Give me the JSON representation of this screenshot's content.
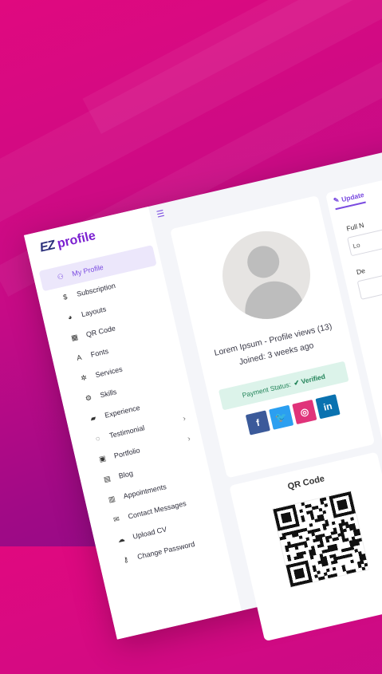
{
  "logo": {
    "mark": "EZ",
    "text": "profile"
  },
  "sidebar": {
    "items": [
      {
        "label": "My Profile",
        "icon": "user-icon",
        "glyph": "⚇",
        "active": true
      },
      {
        "label": "Subscription",
        "icon": "dollar-icon",
        "glyph": "$"
      },
      {
        "label": "Layouts",
        "icon": "palette-icon",
        "glyph": "◕"
      },
      {
        "label": "QR Code",
        "icon": "qrcode-icon",
        "glyph": "▦"
      },
      {
        "label": "Fonts",
        "icon": "font-icon",
        "glyph": "A"
      },
      {
        "label": "Services",
        "icon": "gear-icon",
        "glyph": "✲"
      },
      {
        "label": "Skills",
        "icon": "gears-icon",
        "glyph": "⚙"
      },
      {
        "label": "Experience",
        "icon": "book-icon",
        "glyph": "▰"
      },
      {
        "label": "Testimonial",
        "icon": "comment-icon",
        "glyph": "◌",
        "chevron": "›"
      },
      {
        "label": "Portfolio",
        "icon": "id-card-icon",
        "glyph": "▣",
        "chevron": "›"
      },
      {
        "label": "Blog",
        "icon": "file-icon",
        "glyph": "▤"
      },
      {
        "label": "Appointments",
        "icon": "calendar-icon",
        "glyph": "▥"
      },
      {
        "label": "Contact Messages",
        "icon": "envelope-icon",
        "glyph": "✉"
      },
      {
        "label": "Upload CV",
        "icon": "cloud-upload-icon",
        "glyph": "☁"
      },
      {
        "label": "Change Password",
        "icon": "key-icon",
        "glyph": "⚷"
      }
    ]
  },
  "profile": {
    "name_line": "Lorem Ipsum - Profile views (13)",
    "joined": "Joined: 3 weeks ago",
    "payment_label": "Payment Status:",
    "payment_value": "✔ Verified",
    "socials": [
      {
        "icon": "facebook-icon",
        "glyph": "f"
      },
      {
        "icon": "twitter-icon",
        "glyph": "🐦"
      },
      {
        "icon": "instagram-icon",
        "glyph": "◎"
      },
      {
        "icon": "linkedin-icon",
        "glyph": "in"
      }
    ]
  },
  "qr": {
    "title": "QR Code"
  },
  "form": {
    "tab": "Update",
    "full_name_label": "Full N",
    "full_name_value": "Lo",
    "description_label": "De"
  },
  "colors": {
    "accent": "#7a4be0",
    "brand": "#7a1fd0",
    "success": "#23845a"
  }
}
